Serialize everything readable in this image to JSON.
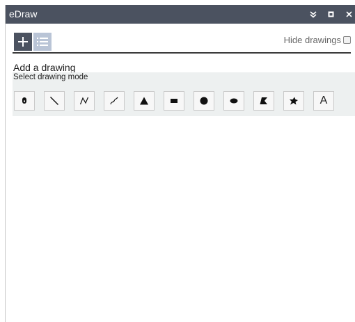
{
  "window": {
    "title": "eDraw",
    "collapse_icon": "double-chevron-down-icon",
    "maximize_icon": "square-icon",
    "close_icon": "close-icon",
    "titlebar_color": "#4b5260"
  },
  "toolbar": {
    "add_tab_icon": "plus-icon",
    "list_tab_icon": "list-icon",
    "active_tab_color": "#4b5260",
    "inactive_tab_color": "#b9c4d6",
    "hide_drawings_label": "Hide drawings",
    "hide_drawings_checked": false
  },
  "add_drawing": {
    "heading": "Add a drawing",
    "select_mode_label": "Select drawing mode",
    "section_bg": "#edf0f0",
    "modes": [
      {
        "icon": "point-marker-icon"
      },
      {
        "icon": "line-icon"
      },
      {
        "icon": "polyline-icon"
      },
      {
        "icon": "freehand-line-icon"
      },
      {
        "icon": "triangle-icon"
      },
      {
        "icon": "rectangle-icon"
      },
      {
        "icon": "circle-icon"
      },
      {
        "icon": "ellipse-icon"
      },
      {
        "icon": "polygon-icon"
      },
      {
        "icon": "freehand-polygon-icon"
      },
      {
        "icon": "text-icon",
        "label": "A"
      }
    ]
  }
}
